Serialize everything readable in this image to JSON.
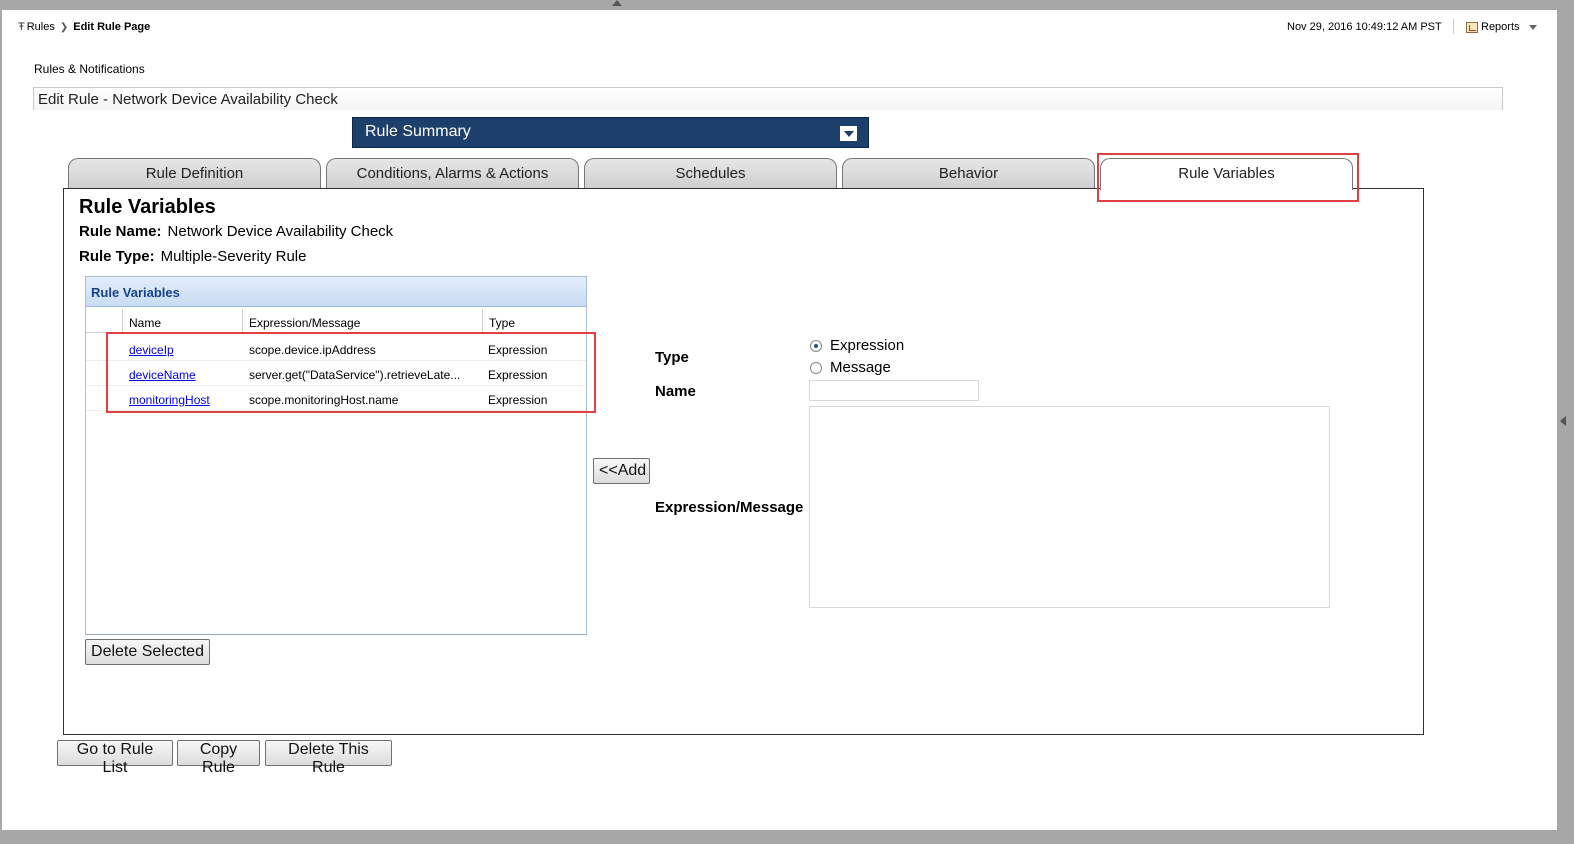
{
  "breadcrumb": {
    "root": "Rules",
    "current": "Edit Rule Page"
  },
  "header": {
    "timestamp": "Nov 29, 2016 10:49:12 AM PST",
    "reports_label": "Reports"
  },
  "section_label": "Rules & Notifications",
  "edit_title": "Edit Rule - Network Device Availability Check",
  "rule_summary": {
    "label": "Rule Summary"
  },
  "tabs": [
    {
      "label": "Rule Definition"
    },
    {
      "label": "Conditions, Alarms & Actions"
    },
    {
      "label": "Schedules"
    },
    {
      "label": "Behavior"
    },
    {
      "label": "Rule Variables",
      "active": true
    }
  ],
  "panel": {
    "heading": "Rule Variables",
    "rule_name_label": "Rule Name:",
    "rule_name_value": "Network Device Availability Check",
    "rule_type_label": "Rule Type:",
    "rule_type_value": "Multiple-Severity Rule"
  },
  "grid": {
    "title": "Rule Variables",
    "columns": [
      "Name",
      "Expression/Message",
      "Type"
    ],
    "rows": [
      {
        "name": "deviceIp",
        "expression": "scope.device.ipAddress",
        "type": "Expression"
      },
      {
        "name": "deviceName",
        "expression": "server.get(\"DataService\").retrieveLate...",
        "type": "Expression"
      },
      {
        "name": "monitoringHost",
        "expression": "scope.monitoringHost.name",
        "type": "Expression"
      }
    ],
    "delete_button": "Delete Selected"
  },
  "add_button": "<<Add",
  "form": {
    "type_label": "Type",
    "type_options": [
      {
        "label": "Expression",
        "checked": true
      },
      {
        "label": "Message",
        "checked": false
      }
    ],
    "name_label": "Name",
    "name_value": "",
    "expression_label": "Expression/Message",
    "expression_value": ""
  },
  "footer_buttons": {
    "go_to_list": "Go to Rule List",
    "copy_rule": "Copy Rule",
    "delete_rule": "Delete This Rule"
  },
  "colors": {
    "rule_summary_bg": "#1d3f6b",
    "highlight_red": "#e04040",
    "grid_title_text": "#15428b",
    "link": "#0000ee"
  }
}
